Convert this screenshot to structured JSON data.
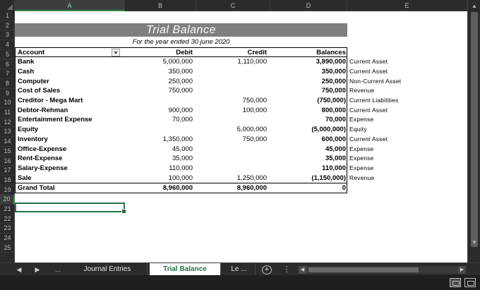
{
  "columns": [
    "A",
    "B",
    "C",
    "D",
    "E"
  ],
  "rows": [
    "1",
    "2",
    "3",
    "4",
    "5",
    "6",
    "7",
    "8",
    "9",
    "10",
    "11",
    "12",
    "13",
    "14",
    "15",
    "16",
    "17",
    "18",
    "19",
    "20",
    "21",
    "22",
    "23",
    "24",
    "25"
  ],
  "selected_column": "A",
  "selected_row": "20",
  "title": "Trial Balance",
  "subtitle": "For the year ended 30 june 2020",
  "table": {
    "headers": {
      "account": "Account",
      "debit": "Debit",
      "credit": "Credit",
      "balances": "Balances"
    },
    "rows": [
      {
        "account": "Bank",
        "debit": "5,000,000",
        "credit": "1,110,000",
        "balance": "3,890,000",
        "type": "Current Asset"
      },
      {
        "account": "Cash",
        "debit": "350,000",
        "credit": "",
        "balance": "350,000",
        "type": "Current Asset"
      },
      {
        "account": "Computer",
        "debit": "250,000",
        "credit": "",
        "balance": "250,000",
        "type": "Non-Current Asset"
      },
      {
        "account": "Cost of Sales",
        "debit": "750,000",
        "credit": "",
        "balance": "750,000",
        "type": "Revenue"
      },
      {
        "account": "Creditor - Mega Mart",
        "debit": "",
        "credit": "750,000",
        "balance": "(750,000)",
        "type": "Current Liabilities"
      },
      {
        "account": "Debtor-Rehman",
        "debit": "900,000",
        "credit": "100,000",
        "balance": "800,000",
        "type": "Current Asset"
      },
      {
        "account": "Entertainment Expense",
        "debit": "70,000",
        "credit": "",
        "balance": "70,000",
        "type": "Expense"
      },
      {
        "account": "Equity",
        "debit": "",
        "credit": "5,000,000",
        "balance": "(5,000,000)",
        "type": "Equity"
      },
      {
        "account": "Inventory",
        "debit": "1,350,000",
        "credit": "750,000",
        "balance": "600,000",
        "type": "Current Asset"
      },
      {
        "account": "Office-Expense",
        "debit": "45,000",
        "credit": "",
        "balance": "45,000",
        "type": "Expense"
      },
      {
        "account": "Rent-Expense",
        "debit": "35,000",
        "credit": "",
        "balance": "35,000",
        "type": "Expense"
      },
      {
        "account": "Salary-Expense",
        "debit": "110,000",
        "credit": "",
        "balance": "110,000",
        "type": "Expense"
      },
      {
        "account": "Sale",
        "debit": "100,000",
        "credit": "1,250,000",
        "balance": "(1,150,000)",
        "type": "Revenue"
      }
    ],
    "total": {
      "account": "Grand Total",
      "debit": "8,960,000",
      "credit": "8,960,000",
      "balance": "0"
    }
  },
  "sheet_tabs": {
    "prev_icon": "triangle-left-icon",
    "next_icon": "triangle-right-icon",
    "more_left": "...",
    "tabs": [
      "Journal Entries",
      "Trial Balance",
      "Le ..."
    ],
    "active_tab": "Trial Balance",
    "add_icon": "+",
    "options_icon": "⋮"
  },
  "colors": {
    "accent": "#217346",
    "title_band": "#7f7f7f",
    "background": "#1f1f1f"
  }
}
